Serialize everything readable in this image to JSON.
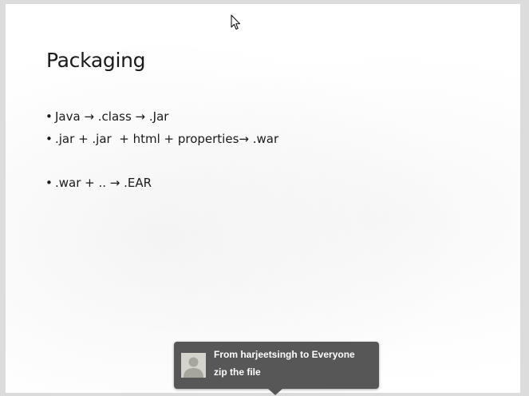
{
  "slide": {
    "title": "Packaging",
    "bullets": [
      "Java → .class → .Jar",
      ".jar + .jar  + html + properties→ .war",
      ".war + .. → .EAR"
    ]
  },
  "chat_notification": {
    "from": "From harjeetsingh to Everyone",
    "message": "zip the file",
    "avatar_icon": "default-user-avatar-icon"
  },
  "cursor_icon": "mouse-pointer-icon",
  "colors": {
    "popup_background": "#575757",
    "slide_background": "#ffffff",
    "frame_background": "#dcdcdc"
  }
}
